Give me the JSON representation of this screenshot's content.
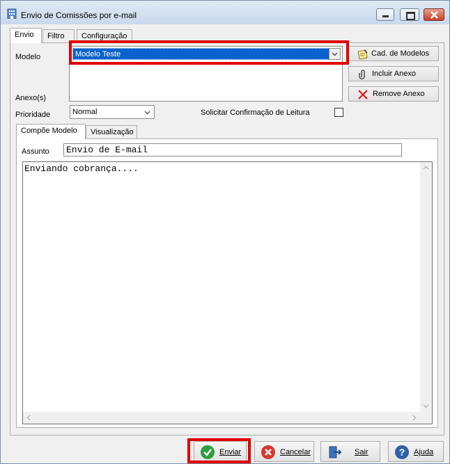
{
  "window": {
    "title": "Envio de Comissões por e-mail"
  },
  "tabs": [
    "Envio",
    "Filtro",
    "Configuração"
  ],
  "envio": {
    "modelo_label": "Modelo",
    "modelo_value": "Modelo Teste",
    "anexos_label": "Anexo(s)",
    "prioridade_label": "Prioridade",
    "prioridade_value": "Normal",
    "confirm_label": "Solicitar Confirmação de Leitura",
    "confirm_checked": false,
    "cad_modelos": "Cad. de Modelos",
    "incluir_anexo": "Incluir Anexo",
    "remove_anexo": "Remove Anexo"
  },
  "inner_tabs": [
    "Compõe Modelo",
    "Visualização"
  ],
  "compose": {
    "assunto_label": "Assunto",
    "assunto_value": "Envio de E-mail",
    "body": "Enviando cobrança...."
  },
  "footer": {
    "enviar": "Enviar",
    "cancelar": "Cancelar",
    "sair": "Sair",
    "ajuda": "Ajuda"
  },
  "colors": {
    "highlight": "#e00000",
    "selection": "#0a63cc",
    "enviar_icon": "#2e9e3e",
    "cancel_icon": "#d5382d",
    "help_icon": "#2f5fa8",
    "exit_icon": "#3b72b8"
  }
}
